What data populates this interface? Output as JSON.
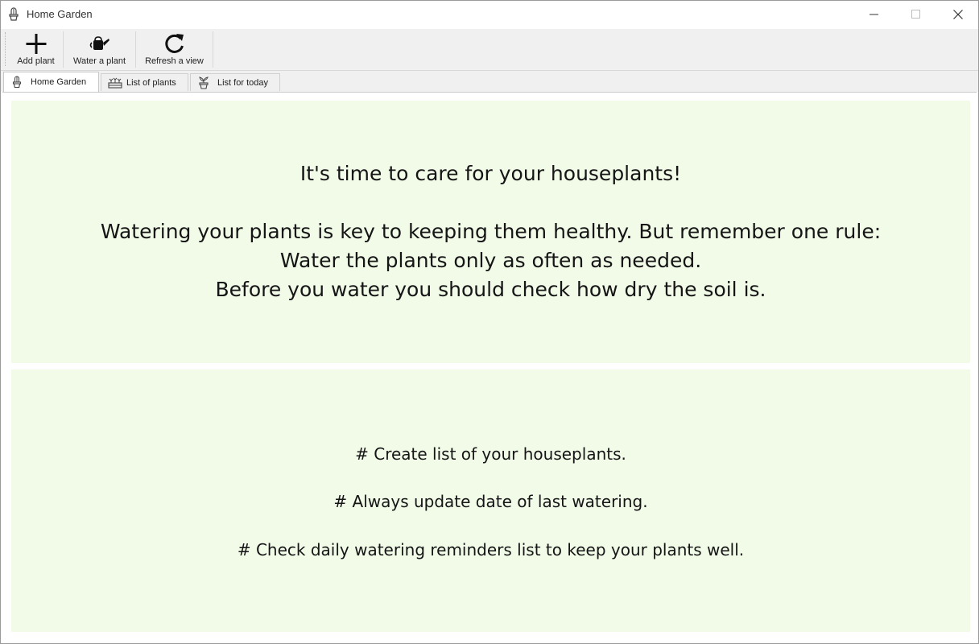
{
  "window": {
    "title": "Home Garden",
    "icon": "cactus-pot-icon",
    "controls": [
      "minimize-icon",
      "maximize-icon",
      "close-icon"
    ]
  },
  "toolbar": {
    "add_label": "Add plant",
    "water_label": "Water a plant",
    "refresh_label": "Refresh a view",
    "icons": [
      "plus-icon",
      "watering-can-icon",
      "refresh-icon"
    ]
  },
  "tabs": [
    {
      "label": "Home Garden",
      "icon": "cactus-pot-icon",
      "active": true
    },
    {
      "label": "List of plants",
      "icon": "garden-bed-icon",
      "active": false
    },
    {
      "label": "List for today",
      "icon": "potted-plant-icon",
      "active": false
    }
  ],
  "home": {
    "headline": "It's time to care for your houseplants!",
    "rule_lines": [
      "Watering your plants is key to keeping them healthy. But remember one rule:",
      "Water the plants only as often as needed.",
      "Before you water you should check how dry the soil is."
    ],
    "tips": [
      "# Create list of your houseplants.",
      "# Always update date of last watering.",
      "# Check daily watering reminders list to keep your plants well."
    ]
  },
  "colors": {
    "panel_background": "#f1fbe8",
    "toolbar_background": "#f0f0f0",
    "text": "#151515"
  }
}
